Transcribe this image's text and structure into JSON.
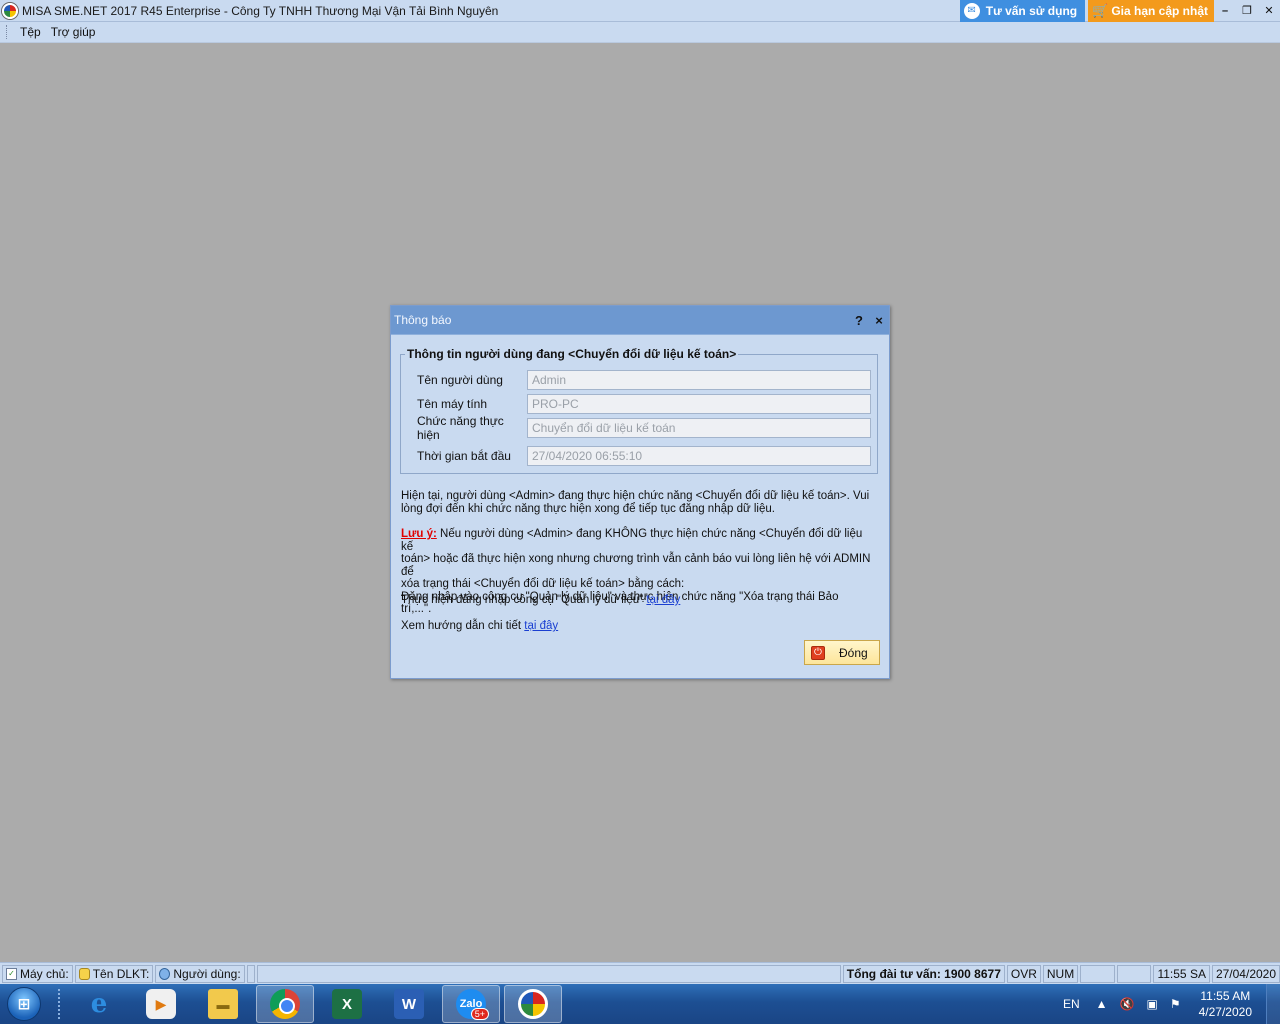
{
  "window": {
    "title": "MISA SME.NET 2017 R45 Enterprise - Công Ty TNHH Thương Mại Vận Tải Bình Nguyên",
    "consult_button": "Tư vấn sử dụng",
    "renew_button": "Gia hạn cập nhật",
    "accent_blue": "#3f8fe0",
    "accent_orange": "#f39a1c"
  },
  "menu": {
    "items": [
      "Tệp",
      "Trợ giúp"
    ]
  },
  "dialog": {
    "title": "Thông báo",
    "help_glyph": "?",
    "close_glyph": "×",
    "group_title": "Thông tin người dùng đang <Chuyển đổi dữ liệu kế toán>",
    "fields": [
      {
        "label": "Tên người dùng",
        "value": "Admin"
      },
      {
        "label": "Tên máy tính",
        "value": "PRO-PC"
      },
      {
        "label": "Chức năng thực hiện",
        "value": "Chuyển đổi dữ liệu kế toán"
      },
      {
        "label": "Thời gian bắt đầu",
        "value": "27/04/2020 06:55:10"
      }
    ],
    "message_line1": "Hiện tại, người dùng <Admin> đang thực hiện chức năng <Chuyển đổi dữ liệu kế toán>. Vui",
    "message_line2": "lòng đợi đến khi chức năng thực hiện xong để tiếp tục đăng nhập dữ liệu.",
    "note_label": "Lưu ý:",
    "note_line1": " Nếu người dùng <Admin> đang KHÔNG thực hiện chức năng <Chuyển đổi dữ liệu kế",
    "note_line2": "toán> hoặc đã thực hiện xong nhưng chương trình vẫn cảnh báo vui lòng liên hệ với ADMIN để",
    "note_line3": "xóa trạng thái <Chuyển đổi dữ liệu kế toán> bằng cách:",
    "note_line4": "Đăng nhập vào công cụ \"Quản lý dữ liệu\" và thực hiện chức năng \"Xóa trạng thái Bảo trì,...\".",
    "login_text": "Thực hiện đăng nhập công cụ \"Quản lý dữ liệu\" ",
    "login_link": "tại đây",
    "guide_text": "Xem hướng dẫn chi tiết ",
    "guide_link": "tại đây",
    "close_button": "Đóng"
  },
  "statusbar": {
    "server": "Máy chủ:",
    "db_name": "Tên DLKT:",
    "user": "Người dùng:",
    "hotline": "Tổng đài tư vấn: 1900 8677",
    "ovr": "OVR",
    "num": "NUM",
    "time": "11:55 SA",
    "date": "27/04/2020"
  },
  "taskbar": {
    "zalo_label": "Zalo",
    "zalo_badge": "5+",
    "excel_glyph": "X",
    "word_glyph": "W",
    "lang": "EN",
    "clock_time": "11:55 AM",
    "clock_date": "4/27/2020"
  }
}
